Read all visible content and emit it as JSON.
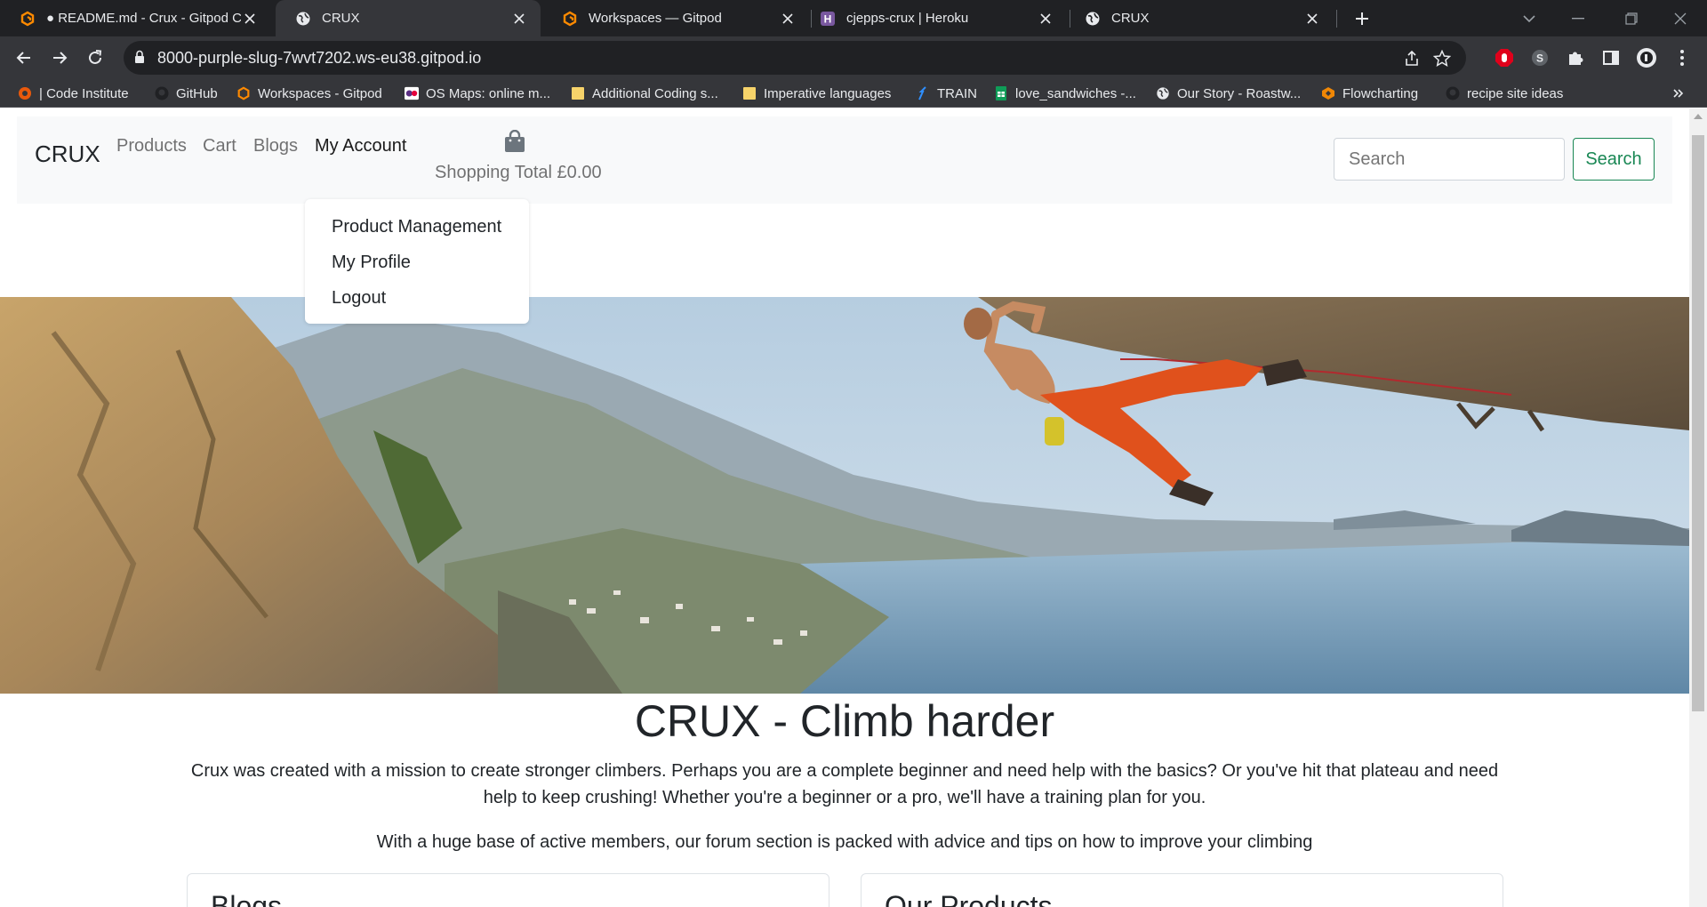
{
  "browser": {
    "tabs": [
      {
        "title": "● README.md - Crux - Gitpod Co",
        "icon": "gitpod-icon",
        "active": false
      },
      {
        "title": "CRUX",
        "icon": "globe-icon",
        "active": true
      },
      {
        "title": "Workspaces — Gitpod",
        "icon": "gitpod-icon",
        "active": false
      },
      {
        "title": "cjepps-crux | Heroku",
        "icon": "heroku-icon",
        "active": false
      },
      {
        "title": "CRUX",
        "icon": "globe-icon",
        "active": false
      }
    ],
    "url": "8000-purple-slug-7wvt7202.ws-eu38.gitpod.io",
    "bookmarks": [
      {
        "label": "| Code Institute",
        "icon": "code-institute-icon"
      },
      {
        "label": "GitHub",
        "icon": "github-icon"
      },
      {
        "label": "Workspaces - Gitpod",
        "icon": "gitpod-icon"
      },
      {
        "label": "OS Maps: online m...",
        "icon": "os-maps-icon"
      },
      {
        "label": "Additional Coding s...",
        "icon": "folder-icon"
      },
      {
        "label": "Imperative languages",
        "icon": "folder-icon"
      },
      {
        "label": "TRAIN",
        "icon": "train-icon"
      },
      {
        "label": "love_sandwiches -...",
        "icon": "sheets-icon"
      },
      {
        "label": "Our Story - Roastw...",
        "icon": "globe-icon"
      },
      {
        "label": "Flowcharting",
        "icon": "flowchart-icon"
      },
      {
        "label": "recipe site ideas",
        "icon": "github-icon"
      }
    ]
  },
  "navbar": {
    "brand": "CRUX",
    "links": [
      "Products",
      "Cart",
      "Blogs",
      "My Account"
    ],
    "shopping_total": "Shopping Total £0.00",
    "search_placeholder": "Search",
    "search_button": "Search"
  },
  "account_menu": {
    "items": [
      "Product Management",
      "My Profile",
      "Logout"
    ]
  },
  "hero": {
    "title": "CRUX - Climb harder",
    "paragraph_1": "Crux was created with a mission to create stronger climbers. Perhaps you are a complete beginner and need help with the basics? Or you've hit that plateau and need help to keep crushing! Whether you're a beginner or a pro, we'll have a training plan for you.",
    "paragraph_2": "With a huge base of active members, our forum section is packed with advice and tips on how to improve your climbing"
  },
  "cards": {
    "blogs_title": "Blogs",
    "products_title": "Our Products"
  },
  "colors": {
    "accent_green": "#198754",
    "navbar_bg": "#f8f9fa",
    "chrome_dark": "#202124",
    "chrome_mid": "#35363a"
  }
}
